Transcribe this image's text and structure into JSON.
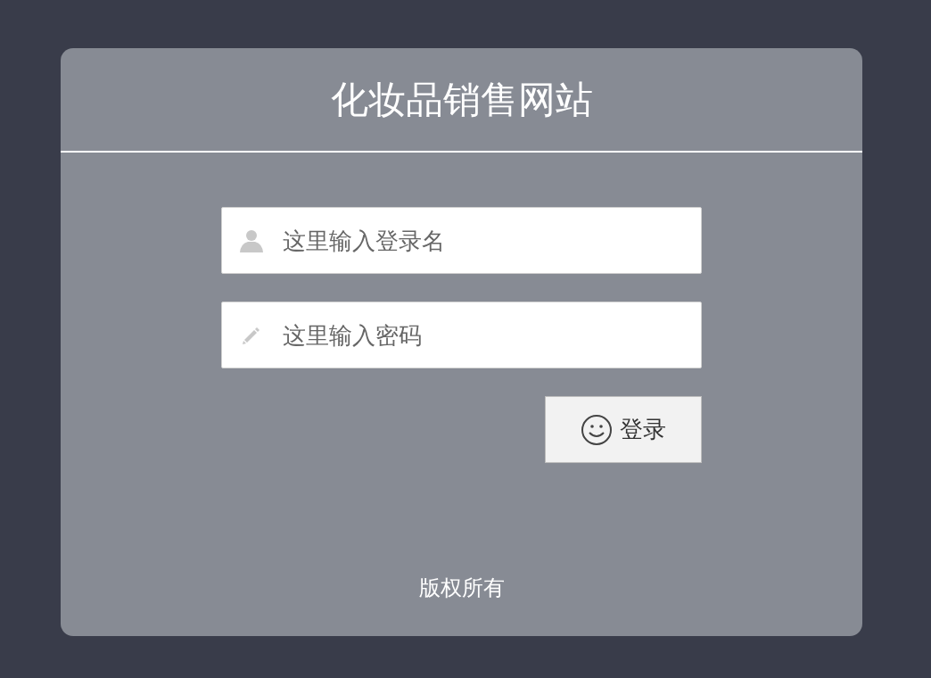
{
  "title": "化妆品销售网站",
  "fields": [
    {
      "kind": "user",
      "placeholder": "这里输入登录名"
    },
    {
      "kind": "password",
      "placeholder": "这里输入密码"
    }
  ],
  "login_button": {
    "label": "登录"
  },
  "footer": "版权所有"
}
